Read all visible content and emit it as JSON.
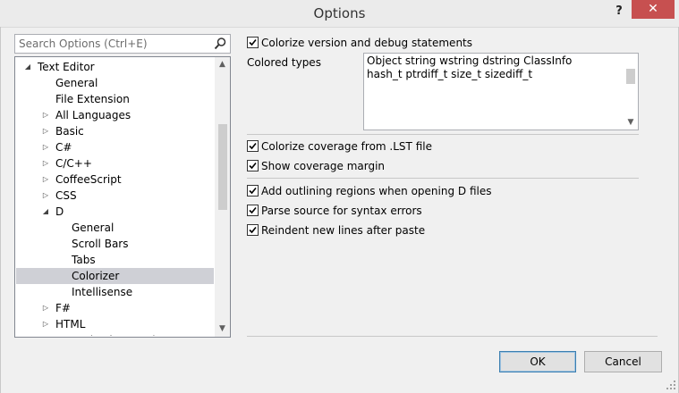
{
  "window": {
    "title": "Options",
    "help_glyph": "?",
    "close_glyph": "✕"
  },
  "search": {
    "placeholder": "Search Options (Ctrl+E)",
    "icon": "search-icon"
  },
  "tree": {
    "items": [
      {
        "label": "Text Editor",
        "expander": "expanded"
      },
      {
        "label": "General",
        "expander": "none"
      },
      {
        "label": "File Extension",
        "expander": "none"
      },
      {
        "label": "All Languages",
        "expander": "collapsed"
      },
      {
        "label": "Basic",
        "expander": "collapsed"
      },
      {
        "label": "C#",
        "expander": "collapsed"
      },
      {
        "label": "C/C++",
        "expander": "collapsed"
      },
      {
        "label": "CoffeeScript",
        "expander": "collapsed"
      },
      {
        "label": "CSS",
        "expander": "collapsed"
      },
      {
        "label": "D",
        "expander": "expanded"
      },
      {
        "label": "General",
        "expander": "none"
      },
      {
        "label": "Scroll Bars",
        "expander": "none"
      },
      {
        "label": "Tabs",
        "expander": "none"
      },
      {
        "label": "Colorizer",
        "expander": "none",
        "selected": true
      },
      {
        "label": "Intellisense",
        "expander": "none"
      },
      {
        "label": "F#",
        "expander": "collapsed"
      },
      {
        "label": "HTML",
        "expander": "collapsed"
      },
      {
        "label": "HTML (Web Forms)",
        "expander": "collapsed"
      }
    ]
  },
  "options": {
    "colorize_version": {
      "label": "Colorize version and debug statements",
      "checked": true
    },
    "colored_types": {
      "label": "Colored types",
      "lines": [
        "Object string wstring dstring ClassInfo",
        "hash_t ptrdiff_t size_t sizediff_t"
      ]
    },
    "colorize_coverage": {
      "label": "Colorize coverage from .LST file",
      "checked": true
    },
    "show_coverage_margin": {
      "label": "Show coverage margin",
      "checked": true
    },
    "outlining": {
      "label": "Add outlining regions when opening D files",
      "checked": true
    },
    "parse_source": {
      "label": "Parse source for syntax errors",
      "checked": true
    },
    "reindent": {
      "label": "Reindent new lines after paste",
      "checked": true
    }
  },
  "buttons": {
    "ok": "OK",
    "cancel": "Cancel"
  }
}
